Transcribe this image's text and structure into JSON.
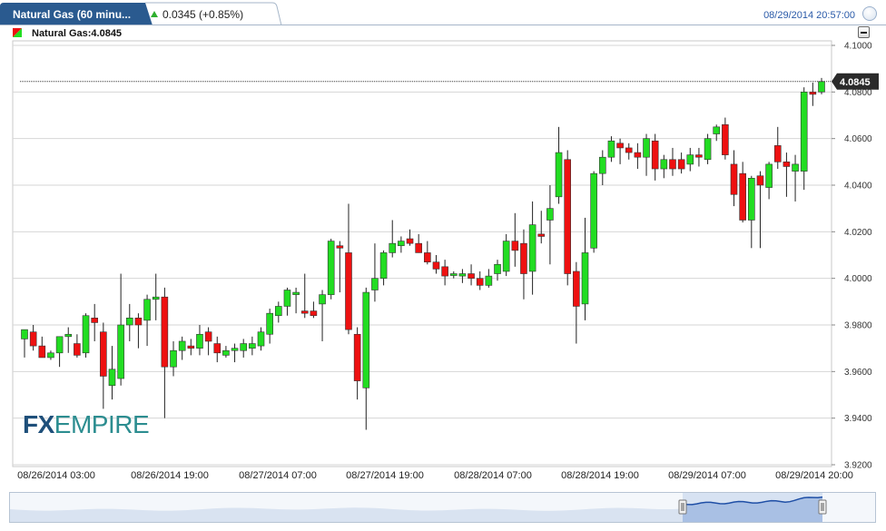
{
  "header": {
    "tab_title": "Natural Gas (60 minu...",
    "change": "0.0345 (+0.85%)",
    "timestamp": "08/29/2014 20:57:00"
  },
  "legend": {
    "label": "Natural Gas:4.0845"
  },
  "colors": {
    "up": "#22dd22",
    "down": "#ee1111",
    "tab": "#2a5a8f",
    "grid": "#d6d6d6",
    "navigator_fill": "#a9c0e4",
    "navigator_line": "#1f4fa6"
  },
  "watermark": {
    "fx": "FX",
    "empire": "EMPIRE"
  },
  "chart_data": {
    "type": "candlestick",
    "title": "Natural Gas:4.0845",
    "y_ticks": [
      "4.1000",
      "4.0800",
      "4.0600",
      "4.0400",
      "4.0200",
      "4.0000",
      "3.9800",
      "3.9600",
      "3.9400",
      "3.9200"
    ],
    "ylim": [
      3.92,
      4.1
    ],
    "x_labels": [
      "08/26/2014 03:00",
      "08/26/2014 19:00",
      "08/27/2014 07:00",
      "08/27/2014 19:00",
      "08/28/2014 07:00",
      "08/28/2014 19:00",
      "08/29/2014 07:00",
      "08/29/2014 20:00"
    ],
    "last_price": "4.0845",
    "grid": true,
    "candles": [
      {
        "o": 3.974,
        "h": 3.978,
        "l": 3.966,
        "c": 3.978
      },
      {
        "o": 3.977,
        "h": 3.98,
        "l": 3.969,
        "c": 3.971
      },
      {
        "o": 3.971,
        "h": 3.975,
        "l": 3.966,
        "c": 3.966
      },
      {
        "o": 3.966,
        "h": 3.969,
        "l": 3.965,
        "c": 3.968
      },
      {
        "o": 3.968,
        "h": 3.975,
        "l": 3.962,
        "c": 3.975
      },
      {
        "o": 3.975,
        "h": 3.979,
        "l": 3.968,
        "c": 3.976
      },
      {
        "o": 3.972,
        "h": 3.976,
        "l": 3.966,
        "c": 3.967
      },
      {
        "o": 3.968,
        "h": 3.985,
        "l": 3.966,
        "c": 3.984
      },
      {
        "o": 3.983,
        "h": 3.989,
        "l": 3.973,
        "c": 3.981
      },
      {
        "o": 3.977,
        "h": 3.981,
        "l": 3.944,
        "c": 3.958
      },
      {
        "o": 3.954,
        "h": 3.971,
        "l": 3.948,
        "c": 3.961
      },
      {
        "o": 3.957,
        "h": 4.002,
        "l": 3.954,
        "c": 3.98
      },
      {
        "o": 3.98,
        "h": 3.989,
        "l": 3.973,
        "c": 3.983
      },
      {
        "o": 3.983,
        "h": 3.985,
        "l": 3.97,
        "c": 3.98
      },
      {
        "o": 3.982,
        "h": 3.993,
        "l": 3.971,
        "c": 3.991
      },
      {
        "o": 3.991,
        "h": 4.002,
        "l": 3.982,
        "c": 3.992
      },
      {
        "o": 3.992,
        "h": 3.996,
        "l": 3.94,
        "c": 3.962
      },
      {
        "o": 3.962,
        "h": 3.973,
        "l": 3.958,
        "c": 3.969
      },
      {
        "o": 3.969,
        "h": 3.975,
        "l": 3.965,
        "c": 3.973
      },
      {
        "o": 3.971,
        "h": 3.974,
        "l": 3.967,
        "c": 3.97
      },
      {
        "o": 3.97,
        "h": 3.98,
        "l": 3.967,
        "c": 3.976
      },
      {
        "o": 3.977,
        "h": 3.979,
        "l": 3.967,
        "c": 3.973
      },
      {
        "o": 3.972,
        "h": 3.975,
        "l": 3.964,
        "c": 3.968
      },
      {
        "o": 3.967,
        "h": 3.971,
        "l": 3.966,
        "c": 3.969
      },
      {
        "o": 3.969,
        "h": 3.972,
        "l": 3.964,
        "c": 3.97
      },
      {
        "o": 3.969,
        "h": 3.974,
        "l": 3.966,
        "c": 3.972
      },
      {
        "o": 3.97,
        "h": 3.975,
        "l": 3.967,
        "c": 3.972
      },
      {
        "o": 3.971,
        "h": 3.979,
        "l": 3.969,
        "c": 3.977
      },
      {
        "o": 3.976,
        "h": 3.987,
        "l": 3.972,
        "c": 3.985
      },
      {
        "o": 3.984,
        "h": 3.99,
        "l": 3.981,
        "c": 3.988
      },
      {
        "o": 3.988,
        "h": 3.996,
        "l": 3.984,
        "c": 3.995
      },
      {
        "o": 3.993,
        "h": 3.996,
        "l": 3.985,
        "c": 3.994
      },
      {
        "o": 3.986,
        "h": 4.002,
        "l": 3.983,
        "c": 3.985
      },
      {
        "o": 3.986,
        "h": 3.99,
        "l": 3.983,
        "c": 3.984
      },
      {
        "o": 3.989,
        "h": 3.995,
        "l": 3.973,
        "c": 3.993
      },
      {
        "o": 3.993,
        "h": 4.017,
        "l": 3.991,
        "c": 4.016
      },
      {
        "o": 4.014,
        "h": 4.016,
        "l": 3.994,
        "c": 4.013
      },
      {
        "o": 4.011,
        "h": 4.032,
        "l": 3.976,
        "c": 3.978
      },
      {
        "o": 3.976,
        "h": 3.979,
        "l": 3.948,
        "c": 3.956
      },
      {
        "o": 3.953,
        "h": 3.996,
        "l": 3.935,
        "c": 3.994
      },
      {
        "o": 3.995,
        "h": 4.015,
        "l": 3.99,
        "c": 4.0
      },
      {
        "o": 4.0,
        "h": 4.012,
        "l": 3.997,
        "c": 4.011
      },
      {
        "o": 4.011,
        "h": 4.025,
        "l": 4.009,
        "c": 4.015
      },
      {
        "o": 4.014,
        "h": 4.018,
        "l": 4.011,
        "c": 4.016
      },
      {
        "o": 4.017,
        "h": 4.021,
        "l": 4.014,
        "c": 4.015
      },
      {
        "o": 4.015,
        "h": 4.019,
        "l": 4.011,
        "c": 4.011
      },
      {
        "o": 4.011,
        "h": 4.016,
        "l": 4.006,
        "c": 4.007
      },
      {
        "o": 4.007,
        "h": 4.01,
        "l": 4.002,
        "c": 4.004
      },
      {
        "o": 4.005,
        "h": 4.008,
        "l": 3.997,
        "c": 4.001
      },
      {
        "o": 4.002,
        "h": 4.003,
        "l": 4.0,
        "c": 4.002
      },
      {
        "o": 4.001,
        "h": 4.004,
        "l": 3.998,
        "c": 4.002
      },
      {
        "o": 4.002,
        "h": 4.006,
        "l": 3.997,
        "c": 4.0
      },
      {
        "o": 4.0,
        "h": 4.003,
        "l": 3.995,
        "c": 3.997
      },
      {
        "o": 3.997,
        "h": 4.004,
        "l": 3.996,
        "c": 4.001
      },
      {
        "o": 4.002,
        "h": 4.008,
        "l": 3.999,
        "c": 4.006
      },
      {
        "o": 4.003,
        "h": 4.019,
        "l": 4.001,
        "c": 4.016
      },
      {
        "o": 4.016,
        "h": 4.028,
        "l": 4.005,
        "c": 4.012
      },
      {
        "o": 4.015,
        "h": 4.021,
        "l": 3.991,
        "c": 4.002
      },
      {
        "o": 4.003,
        "h": 4.033,
        "l": 3.993,
        "c": 4.023
      },
      {
        "o": 4.019,
        "h": 4.029,
        "l": 4.015,
        "c": 4.018
      },
      {
        "o": 4.025,
        "h": 4.04,
        "l": 4.006,
        "c": 4.03
      },
      {
        "o": 4.035,
        "h": 4.065,
        "l": 4.032,
        "c": 4.054
      },
      {
        "o": 4.051,
        "h": 4.055,
        "l": 3.997,
        "c": 4.002
      },
      {
        "o": 4.003,
        "h": 4.007,
        "l": 3.972,
        "c": 3.988
      },
      {
        "o": 3.989,
        "h": 4.026,
        "l": 3.982,
        "c": 4.011
      },
      {
        "o": 4.013,
        "h": 4.046,
        "l": 4.011,
        "c": 4.045
      },
      {
        "o": 4.045,
        "h": 4.055,
        "l": 4.04,
        "c": 4.052
      },
      {
        "o": 4.052,
        "h": 4.061,
        "l": 4.05,
        "c": 4.059
      },
      {
        "o": 4.058,
        "h": 4.06,
        "l": 4.049,
        "c": 4.056
      },
      {
        "o": 4.056,
        "h": 4.058,
        "l": 4.051,
        "c": 4.054
      },
      {
        "o": 4.054,
        "h": 4.058,
        "l": 4.047,
        "c": 4.052
      },
      {
        "o": 4.052,
        "h": 4.062,
        "l": 4.044,
        "c": 4.06
      },
      {
        "o": 4.059,
        "h": 4.062,
        "l": 4.042,
        "c": 4.047
      },
      {
        "o": 4.047,
        "h": 4.053,
        "l": 4.043,
        "c": 4.051
      },
      {
        "o": 4.051,
        "h": 4.056,
        "l": 4.044,
        "c": 4.047
      },
      {
        "o": 4.051,
        "h": 4.054,
        "l": 4.045,
        "c": 4.047
      },
      {
        "o": 4.049,
        "h": 4.056,
        "l": 4.046,
        "c": 4.053
      },
      {
        "o": 4.053,
        "h": 4.056,
        "l": 4.048,
        "c": 4.052
      },
      {
        "o": 4.051,
        "h": 4.062,
        "l": 4.049,
        "c": 4.06
      },
      {
        "o": 4.062,
        "h": 4.066,
        "l": 4.059,
        "c": 4.065
      },
      {
        "o": 4.066,
        "h": 4.069,
        "l": 4.051,
        "c": 4.053
      },
      {
        "o": 4.049,
        "h": 4.055,
        "l": 4.031,
        "c": 4.036
      },
      {
        "o": 4.045,
        "h": 4.05,
        "l": 4.024,
        "c": 4.025
      },
      {
        "o": 4.025,
        "h": 4.044,
        "l": 4.013,
        "c": 4.043
      },
      {
        "o": 4.044,
        "h": 4.046,
        "l": 4.013,
        "c": 4.04
      },
      {
        "o": 4.039,
        "h": 4.05,
        "l": 4.034,
        "c": 4.049
      },
      {
        "o": 4.057,
        "h": 4.065,
        "l": 4.047,
        "c": 4.05
      },
      {
        "o": 4.05,
        "h": 4.054,
        "l": 4.035,
        "c": 4.048
      },
      {
        "o": 4.046,
        "h": 4.053,
        "l": 4.033,
        "c": 4.049
      },
      {
        "o": 4.046,
        "h": 4.082,
        "l": 4.038,
        "c": 4.08
      },
      {
        "o": 4.08,
        "h": 4.084,
        "l": 4.074,
        "c": 4.079
      },
      {
        "o": 4.08,
        "h": 4.086,
        "l": 4.079,
        "c": 4.0845
      }
    ]
  }
}
